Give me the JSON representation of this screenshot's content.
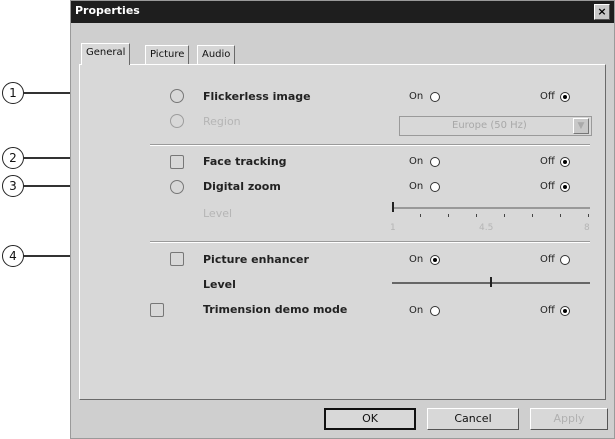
{
  "window": {
    "title": "Properties",
    "close_glyph": "×"
  },
  "tabs": [
    "General",
    "Picture",
    "Audio"
  ],
  "callouts": [
    "1",
    "2",
    "3",
    "4"
  ],
  "settings": {
    "flickerless": {
      "label": "Flickerless image",
      "on": "On",
      "off": "Off",
      "selected": "off",
      "icon": "flicker-icon"
    },
    "region": {
      "label": "Region",
      "value": "Europe (50 Hz)",
      "icon": "globe-icon"
    },
    "face_tracking": {
      "label": "Face tracking",
      "on": "On",
      "off": "Off",
      "selected": "off",
      "icon": "face-icon"
    },
    "digital_zoom": {
      "label": "Digital zoom",
      "on": "On",
      "off": "Off",
      "selected": "off",
      "icon": "magnifier-icon",
      "level_label": "Level",
      "ticks": [
        "1",
        "4.5",
        "8"
      ],
      "level_value": 1
    },
    "picture_enhancer": {
      "label": "Picture enhancer",
      "on": "On",
      "off": "Off",
      "selected": "on",
      "icon": "enhancer-icon",
      "level_label": "Level",
      "level_fraction": 0.5
    },
    "trimension": {
      "label": "Trimension demo mode",
      "on": "On",
      "off": "Off",
      "selected": "off",
      "icon": "trimension-icon"
    }
  },
  "buttons": {
    "ok": "OK",
    "cancel": "Cancel",
    "apply": "Apply"
  }
}
